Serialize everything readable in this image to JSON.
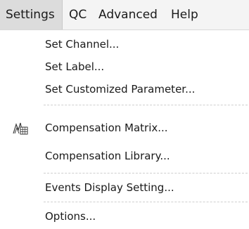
{
  "menubar": {
    "items": [
      {
        "label": "Settings",
        "active": true
      },
      {
        "label": "QC",
        "active": false
      },
      {
        "label": "Advanced",
        "active": false
      },
      {
        "label": "Help",
        "active": false
      }
    ]
  },
  "dropdown": {
    "items": [
      {
        "label": "Set Channel..."
      },
      {
        "label": "Set Label..."
      },
      {
        "label": "Set Customized Parameter..."
      },
      {
        "label": "Compensation Matrix...",
        "icon": "compensation-matrix-icon"
      },
      {
        "label": "Compensation Library..."
      },
      {
        "label": "Events Display Setting..."
      },
      {
        "label": "Options..."
      }
    ]
  },
  "colors": {
    "menubar_bg": "#f4f4f4",
    "active_bg": "#dcdcdc",
    "separator": "#cfcfcf"
  }
}
